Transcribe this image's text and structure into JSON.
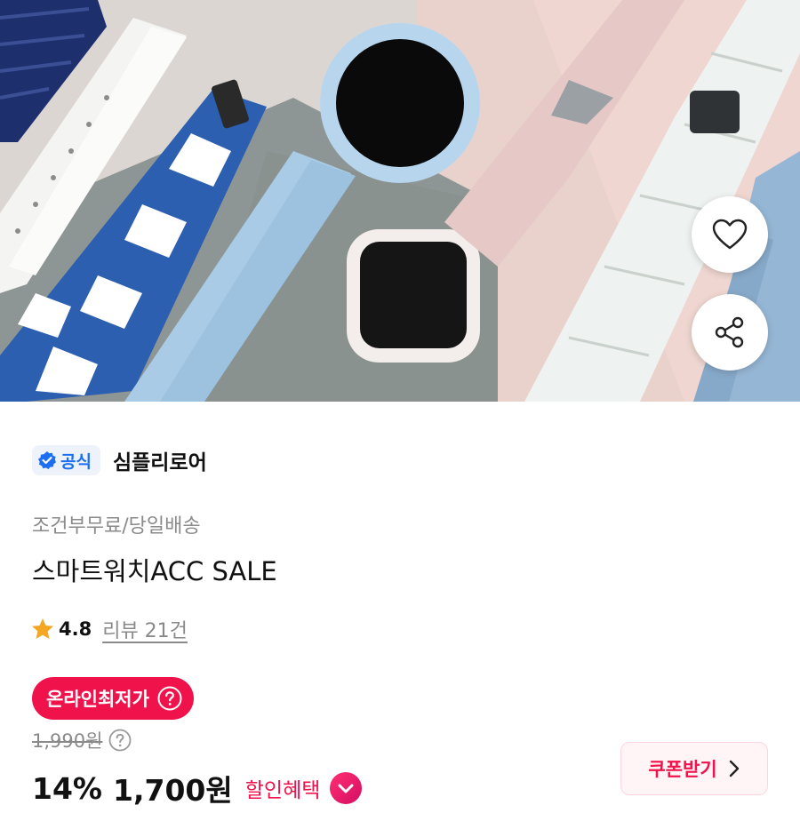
{
  "hero": {
    "image": "smartwatch-bands-product-photo",
    "like_icon": "heart-icon",
    "share_icon": "share-icon"
  },
  "brand": {
    "official_badge": "공식",
    "official_icon": "verified-check-icon",
    "name": "심플리로어"
  },
  "product": {
    "shipping": "조건부무료/당일배송",
    "title": "스마트워치ACC SALE"
  },
  "rating": {
    "icon": "star-icon",
    "score": "4.8",
    "reviews": "리뷰 21건"
  },
  "pricing": {
    "lowest_badge": "온라인최저가",
    "original_price": "1,990원",
    "discount_rate": "14%",
    "sale_price": "1,700원",
    "benefit_label": "할인혜택",
    "coupon_label": "쿠폰받기"
  },
  "colors": {
    "accent": "#f0124b",
    "official_blue": "#1c6ef2",
    "muted_text": "#8a8a8a",
    "star": "#f5a623"
  }
}
